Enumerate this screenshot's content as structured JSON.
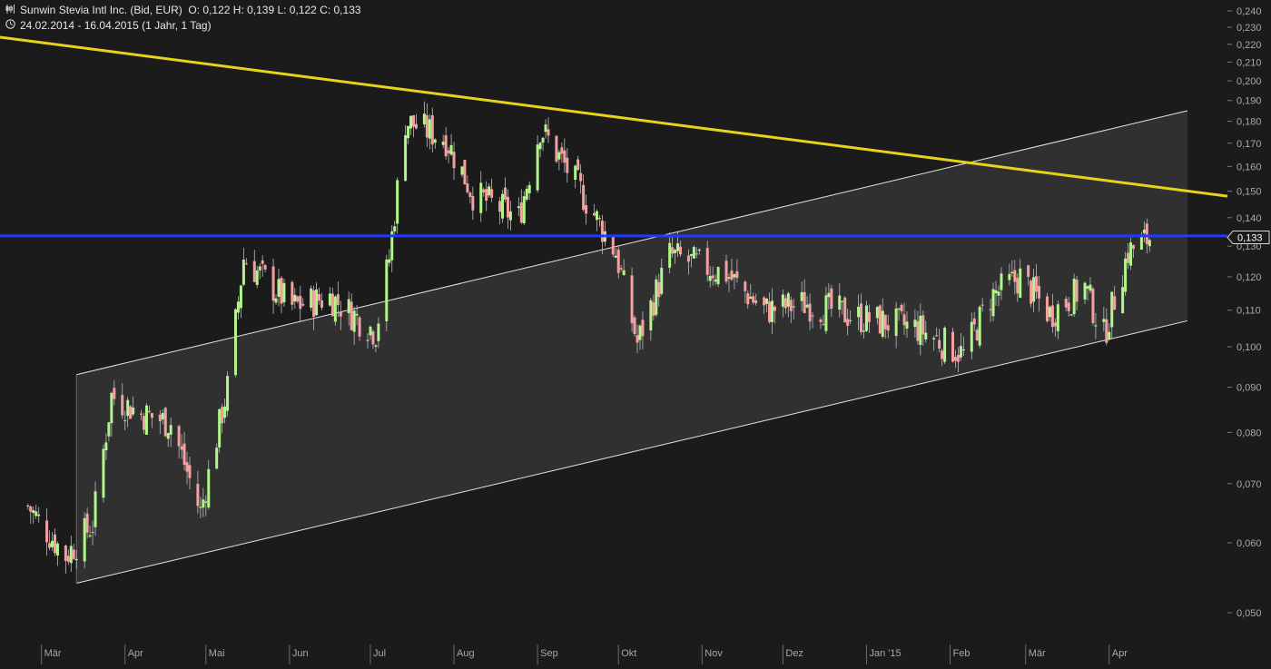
{
  "header": {
    "title": "Sunwin Stevia Intl Inc. (Bid, EUR)",
    "ohlc": "O: 0,122  H: 0,139  L: 0,122  C: 0,133",
    "period": "24.02.2014 - 16.04.2015 (1 Jahr, 1 Tag)",
    "chart_icon": "candlestick-icon",
    "clock_icon": "clock-icon"
  },
  "colors": {
    "background": "#1b1b1b",
    "up": "#b2f58a",
    "down": "#f5a0a0",
    "wick": "#bdbdbd",
    "channel_fill": "#333333",
    "channel_line": "#e6e6e6",
    "resistance_line": "#e8d31a",
    "horizontal_line": "#1f3bff",
    "axis_text": "#a8a8a8"
  },
  "chart_data": {
    "type": "candlestick",
    "y_scale": "log",
    "ylim": [
      0.046,
      0.244
    ],
    "x_axis_labels": [
      "Mär",
      "Apr",
      "Mai",
      "Jun",
      "Jul",
      "Aug",
      "Sep",
      "Okt",
      "Nov",
      "Dez",
      "Jan '15",
      "Feb",
      "Mär",
      "Apr"
    ],
    "y_ticks": [
      "0,240",
      "0,230",
      "0,220",
      "0,210",
      "0,200",
      "0,190",
      "0,180",
      "0,170",
      "0,160",
      "0,150",
      "0,140",
      "0,130",
      "0,120",
      "0,110",
      "0,100",
      "0,090",
      "0,080",
      "0,070",
      "0,060",
      "0,050"
    ],
    "last_price_label": "0,133",
    "last_price": 0.133,
    "anchors": [
      {
        "date": "2014-02-24",
        "close": 0.066
      },
      {
        "date": "2014-03-10",
        "close": 0.058
      },
      {
        "date": "2014-03-20",
        "close": 0.063
      },
      {
        "date": "2014-03-27",
        "close": 0.088
      },
      {
        "date": "2014-04-07",
        "close": 0.084
      },
      {
        "date": "2014-04-18",
        "close": 0.082
      },
      {
        "date": "2014-04-29",
        "close": 0.065
      },
      {
        "date": "2014-05-09",
        "close": 0.09
      },
      {
        "date": "2014-05-15",
        "close": 0.126
      },
      {
        "date": "2014-06-02",
        "close": 0.111
      },
      {
        "date": "2014-06-16",
        "close": 0.114
      },
      {
        "date": "2014-07-03",
        "close": 0.104
      },
      {
        "date": "2014-07-08",
        "close": 0.126
      },
      {
        "date": "2014-07-14",
        "close": 0.18
      },
      {
        "date": "2014-07-29",
        "close": 0.172
      },
      {
        "date": "2014-08-08",
        "close": 0.149
      },
      {
        "date": "2014-08-25",
        "close": 0.14
      },
      {
        "date": "2014-09-02",
        "close": 0.177
      },
      {
        "date": "2014-09-16",
        "close": 0.152
      },
      {
        "date": "2014-09-30",
        "close": 0.128
      },
      {
        "date": "2014-10-08",
        "close": 0.101
      },
      {
        "date": "2014-10-20",
        "close": 0.127
      },
      {
        "date": "2014-11-10",
        "close": 0.121
      },
      {
        "date": "2014-11-24",
        "close": 0.11
      },
      {
        "date": "2014-12-10",
        "close": 0.112
      },
      {
        "date": "2014-12-29",
        "close": 0.108
      },
      {
        "date": "2015-01-20",
        "close": 0.105
      },
      {
        "date": "2015-02-06",
        "close": 0.098
      },
      {
        "date": "2015-02-16",
        "close": 0.114
      },
      {
        "date": "2015-02-27",
        "close": 0.12
      },
      {
        "date": "2015-03-10",
        "close": 0.109
      },
      {
        "date": "2015-03-23",
        "close": 0.117
      },
      {
        "date": "2015-03-30",
        "close": 0.103
      },
      {
        "date": "2015-04-08",
        "close": 0.128
      },
      {
        "date": "2015-04-16",
        "close": 0.133
      }
    ],
    "lines": [
      {
        "name": "resistance",
        "kind": "trendline",
        "start": {
          "date": "2014-02-24",
          "value": 0.222
        },
        "end": {
          "date": "2015-04-16",
          "value": 0.152
        }
      },
      {
        "name": "horizontal",
        "kind": "horizontal",
        "value": 0.1335
      },
      {
        "name": "channel-upper",
        "kind": "trendline",
        "start": {
          "date": "2014-03-14",
          "value": 0.093
        },
        "end": {
          "date": "2015-04-30",
          "value": 0.185
        }
      },
      {
        "name": "channel-lower",
        "kind": "trendline",
        "start": {
          "date": "2014-03-14",
          "value": 0.054
        },
        "end": {
          "date": "2015-04-30",
          "value": 0.107
        }
      }
    ]
  }
}
